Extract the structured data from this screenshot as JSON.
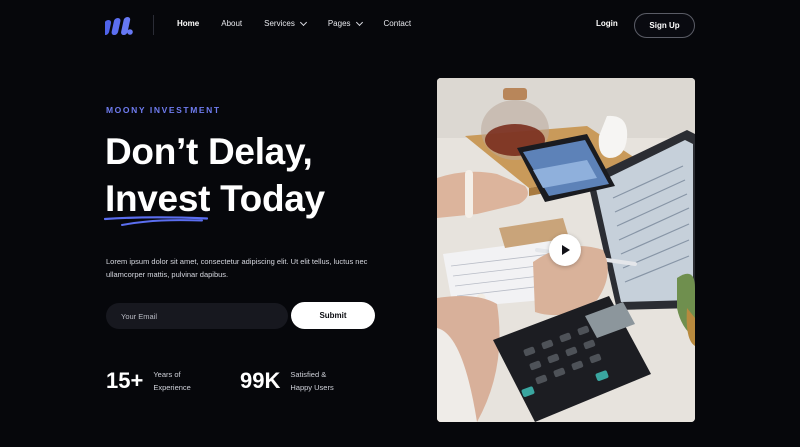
{
  "nav": {
    "logo_icon": "brand-m-logo-icon",
    "links": [
      {
        "label": "Home",
        "active": true
      },
      {
        "label": "About",
        "active": false
      },
      {
        "label": "Services",
        "dropdown": true
      },
      {
        "label": "Pages",
        "dropdown": true
      },
      {
        "label": "Contact",
        "active": false
      }
    ],
    "login_label": "Login",
    "signup_label": "Sign Up"
  },
  "hero": {
    "eyebrow": "MOONY INVESTMENT",
    "headline_line1": "Don’t Delay,",
    "headline_word_highlight": "Invest",
    "headline_line2_rest": " Today",
    "lead": "Lorem ipsum dolor sit amet, consectetur adipiscing elit. Ut elit tellus, luctus nec ullamcorper mattis, pulvinar dapibus.",
    "email_placeholder": "Your Email",
    "submit_label": "Submit"
  },
  "stats": [
    {
      "value": "15+",
      "label_line1": "Years of",
      "label_line2": "Experience"
    },
    {
      "value": "99K",
      "label_line1": "Satisfied &",
      "label_line2": "Happy Users"
    }
  ],
  "media": {
    "image_subject": "person using phone, tablet and calculator",
    "play_icon": "play-icon"
  },
  "colors": {
    "background": "#06070b",
    "accent": "#5b6ef0",
    "text": "#ffffff"
  }
}
